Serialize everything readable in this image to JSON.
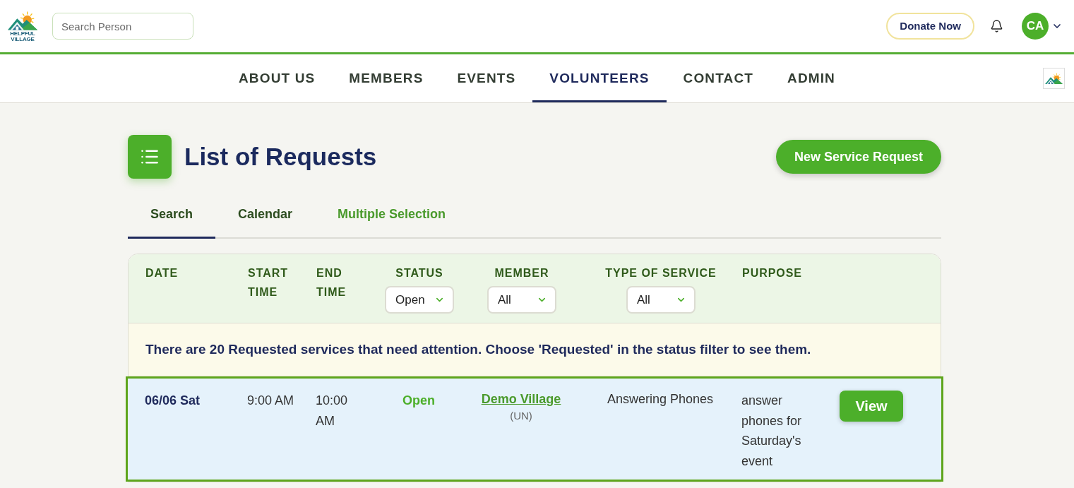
{
  "header": {
    "logo": {
      "lines": [
        "HELPFUL",
        "VILLAGE"
      ]
    },
    "search": {
      "placeholder": "Search Person"
    },
    "donate_button": "Donate Now",
    "avatar": "CA"
  },
  "nav": [
    {
      "label": "ABOUT US",
      "selected": false
    },
    {
      "label": "MEMBERS",
      "selected": false
    },
    {
      "label": "EVENTS",
      "selected": false
    },
    {
      "label": "VOLUNTEERS",
      "selected": true
    },
    {
      "label": "CONTACT",
      "selected": false
    },
    {
      "label": "ADMIN",
      "selected": false
    }
  ],
  "page": {
    "title": "List of Requests",
    "new_request_button": "New Service Request"
  },
  "tabs": [
    {
      "label": "Search",
      "selected": true,
      "kind": "tab"
    },
    {
      "label": "Calendar",
      "selected": false,
      "kind": "tab"
    },
    {
      "label": "Multiple Selection",
      "selected": false,
      "kind": "link"
    }
  ],
  "table": {
    "columns": [
      {
        "label": "DATE"
      },
      {
        "label": "START TIME"
      },
      {
        "label": "END TIME"
      },
      {
        "label": "STATUS",
        "filter": "Open"
      },
      {
        "label": "MEMBER",
        "filter": "All"
      },
      {
        "label": "TYPE OF SERVICE",
        "filter": "All"
      },
      {
        "label": "PURPOSE"
      }
    ],
    "notice": "There are 20 Requested services that need attention. Choose 'Requested' in the status filter to see them.",
    "rows": [
      {
        "date": "06/06 Sat",
        "start_time": "9:00 AM",
        "end_time": "10:00 AM",
        "status": "Open",
        "member": "Demo Village",
        "member_code": "(UN)",
        "type_of_service": "Answering Phones",
        "purpose": "answer phones for Saturday's event",
        "action": "View",
        "selected": true
      }
    ]
  }
}
